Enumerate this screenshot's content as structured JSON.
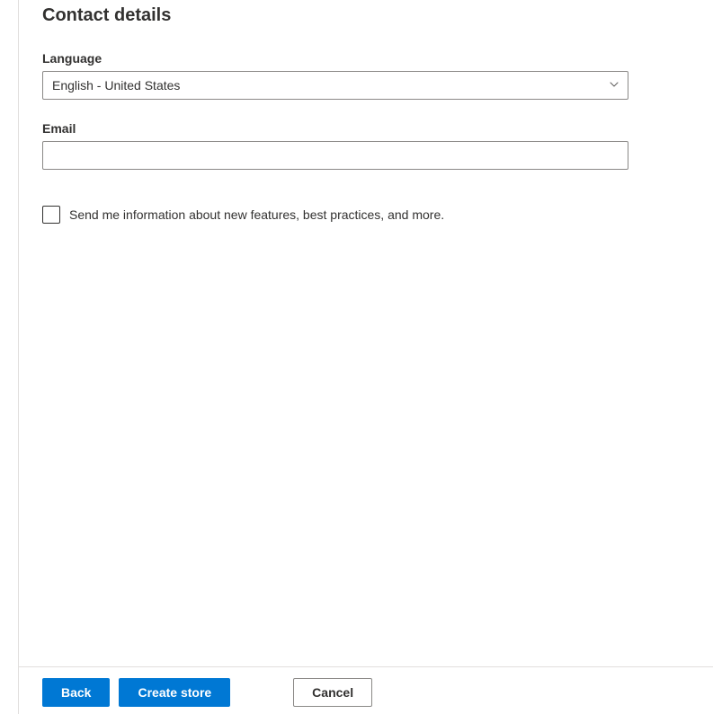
{
  "header": {
    "title": "Contact details"
  },
  "form": {
    "language": {
      "label": "Language",
      "value": "English - United States"
    },
    "email": {
      "label": "Email",
      "value": ""
    },
    "newsletter": {
      "checked": false,
      "label": "Send me information about new features, best practices, and more."
    }
  },
  "footer": {
    "back_label": "Back",
    "create_label": "Create store",
    "cancel_label": "Cancel"
  }
}
